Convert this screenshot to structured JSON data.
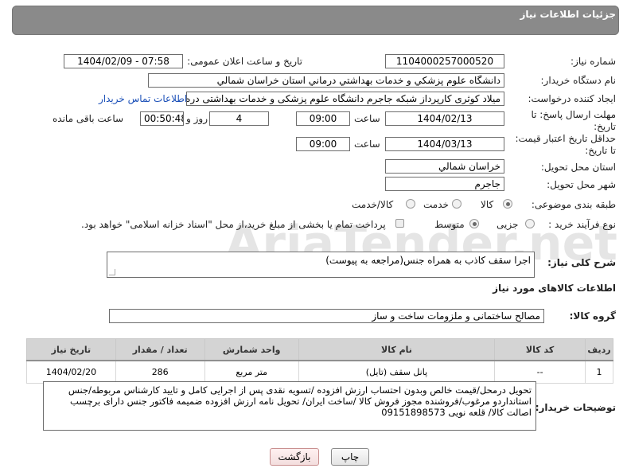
{
  "header": {
    "title": "جزئیات اطلاعات نیاز"
  },
  "fields": {
    "need_number_label": "شماره نیاز:",
    "need_number": "1104000257000520",
    "announce_label": "تاریخ و ساعت اعلان عمومی:",
    "announce_value": "1404/02/09 - 07:58",
    "buyer_org_label": "نام دستگاه خریدار:",
    "buyer_org": "دانشگاه علوم پزشكي و خدمات بهداشتي درماني استان خراسان شمالي",
    "creator_label": "ایجاد کننده درخواست:",
    "creator": "میلاد کوثری کارپرداز شبکه جاجرم دانشگاه علوم پزشکی و خدمات بهداشتی دره",
    "contact_link": "اطلاعات تماس خریدار",
    "deadline_label_line1": "مهلت ارسال پاسخ: تا",
    "deadline_label_line2": "تاریخ:",
    "deadline_date": "1404/02/13",
    "hour_label": "ساعت",
    "deadline_time": "09:00",
    "days_value": "4",
    "days_label": "روز و",
    "remaining_time": "00:50:48",
    "remaining_label": "ساعت باقی مانده",
    "min_validity_label_line1": "حداقل تاریخ اعتبار قیمت:",
    "min_validity_label_line2": "تا تاریخ:",
    "validity_date": "1404/03/13",
    "validity_time": "09:00",
    "province_label": "استان محل تحویل:",
    "province": "خراسان شمالي",
    "city_label": "شهر محل تحویل:",
    "city": "جاجرم",
    "category_label": "طبقه بندی موضوعی:",
    "category_options": [
      "کالا",
      "خدمت",
      "کالا/خدمت"
    ],
    "process_label": "نوع فرآیند خرید :",
    "process_options": [
      "جزیی",
      "متوسط"
    ],
    "payment_note": "پرداخت تمام یا بخشی از مبلغ خرید،از محل \"اسناد خزانه اسلامی\" خواهد بود.",
    "description_label": "شرح کلی نیاز:",
    "description": "اجرا سقف کاذب به همراه جنس(مراجعه به پیوست)",
    "items_section_title": "اطلاعات کالاهای مورد نیاز",
    "goods_group_label": "گروه کالا:",
    "goods_group": "مصالح ساختمانی و ملزومات ساخت و ساز",
    "buyer_notes_label": "توضیحات خریدار:",
    "buyer_notes": "تحویل درمحل/قیمت خالص وبدون احتساب ارزش افزوده /تسویه نقدی پس از اجرایی کامل و تایید کارشناس مربوطه/جنس استانداردو مرغوب/فروشنده مجوز فروش کالا /ساخت ایران/ تحویل  نامه ارزش افزوده ضمیمه  فاکتور جنس دارای برچسب اصالت کالا/ قلعه نویی 09151898573"
  },
  "table": {
    "headers": [
      "ردیف",
      "کد کالا",
      "نام کالا",
      "واحد شمارش",
      "تعداد / مقدار",
      "تاریخ نیاز"
    ],
    "rows": [
      [
        "1",
        "--",
        "پانل سقف (تایل)",
        "متر مربع",
        "286",
        "1404/02/20"
      ]
    ]
  },
  "buttons": {
    "print": "چاپ",
    "back": "بازگشت"
  },
  "watermark": "AriaTender.net",
  "colors": {
    "header": "#8a8a8a",
    "link": "#1a4fb8",
    "back_button": "#f3dede"
  }
}
